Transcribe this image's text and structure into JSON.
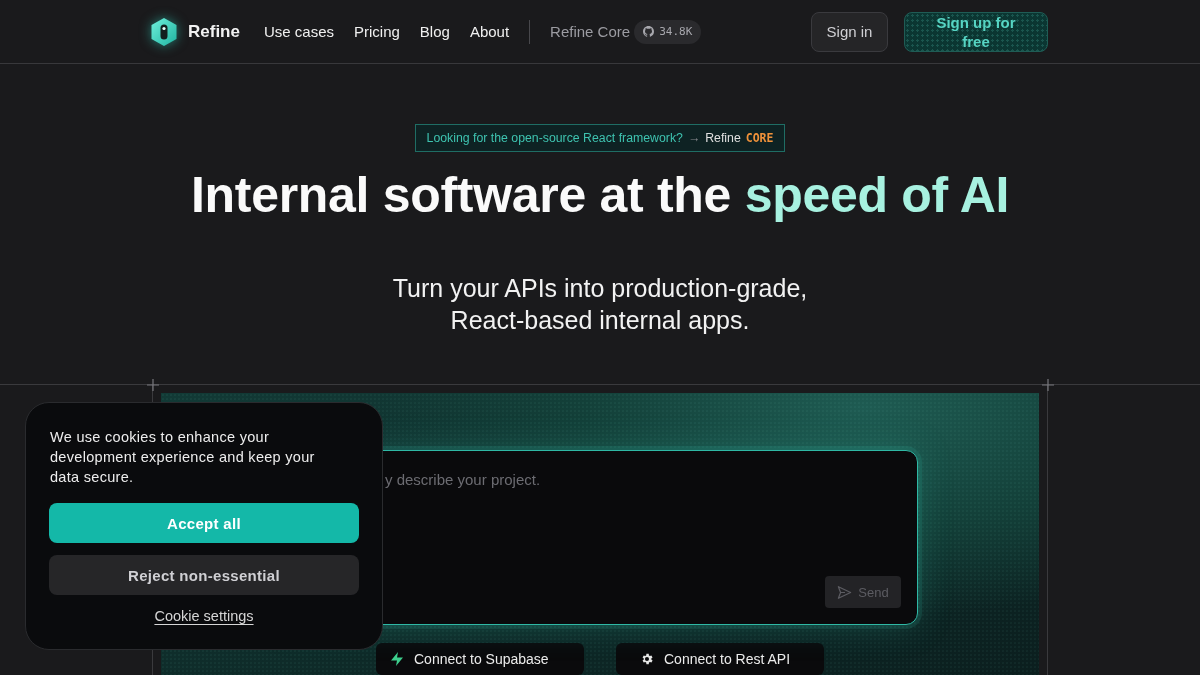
{
  "nav": {
    "brand": "Refine",
    "links": [
      "Use cases",
      "Pricing",
      "Blog",
      "About"
    ],
    "core_link": "Refine Core",
    "stars": "34.8K",
    "sign_in": "Sign in",
    "sign_up": "Sign up for free"
  },
  "hero": {
    "banner": {
      "text": "Looking for the open-source React framework?",
      "arrow": "→",
      "product": "Refine",
      "tag": "CORE"
    },
    "title_lead": "Internal software at the",
    "title_highlight": "speed of AI",
    "subtitle_lines": [
      "Turn your APIs into production-grade,",
      "React-based internal apps."
    ]
  },
  "prompt": {
    "placeholder": "y describe your project.",
    "send": {
      "label": "Send",
      "disabled": true
    }
  },
  "connect_buttons": [
    {
      "kind": "supabase",
      "label": "Connect to Supabase"
    },
    {
      "kind": "rest",
      "label": "Connect to Rest API"
    }
  ],
  "cookie_banner": {
    "message": "We use cookies to enhance your development experience and keep your data secure.",
    "accept": "Accept all",
    "reject": "Reject non-essential",
    "settings": "Cookie settings"
  }
}
